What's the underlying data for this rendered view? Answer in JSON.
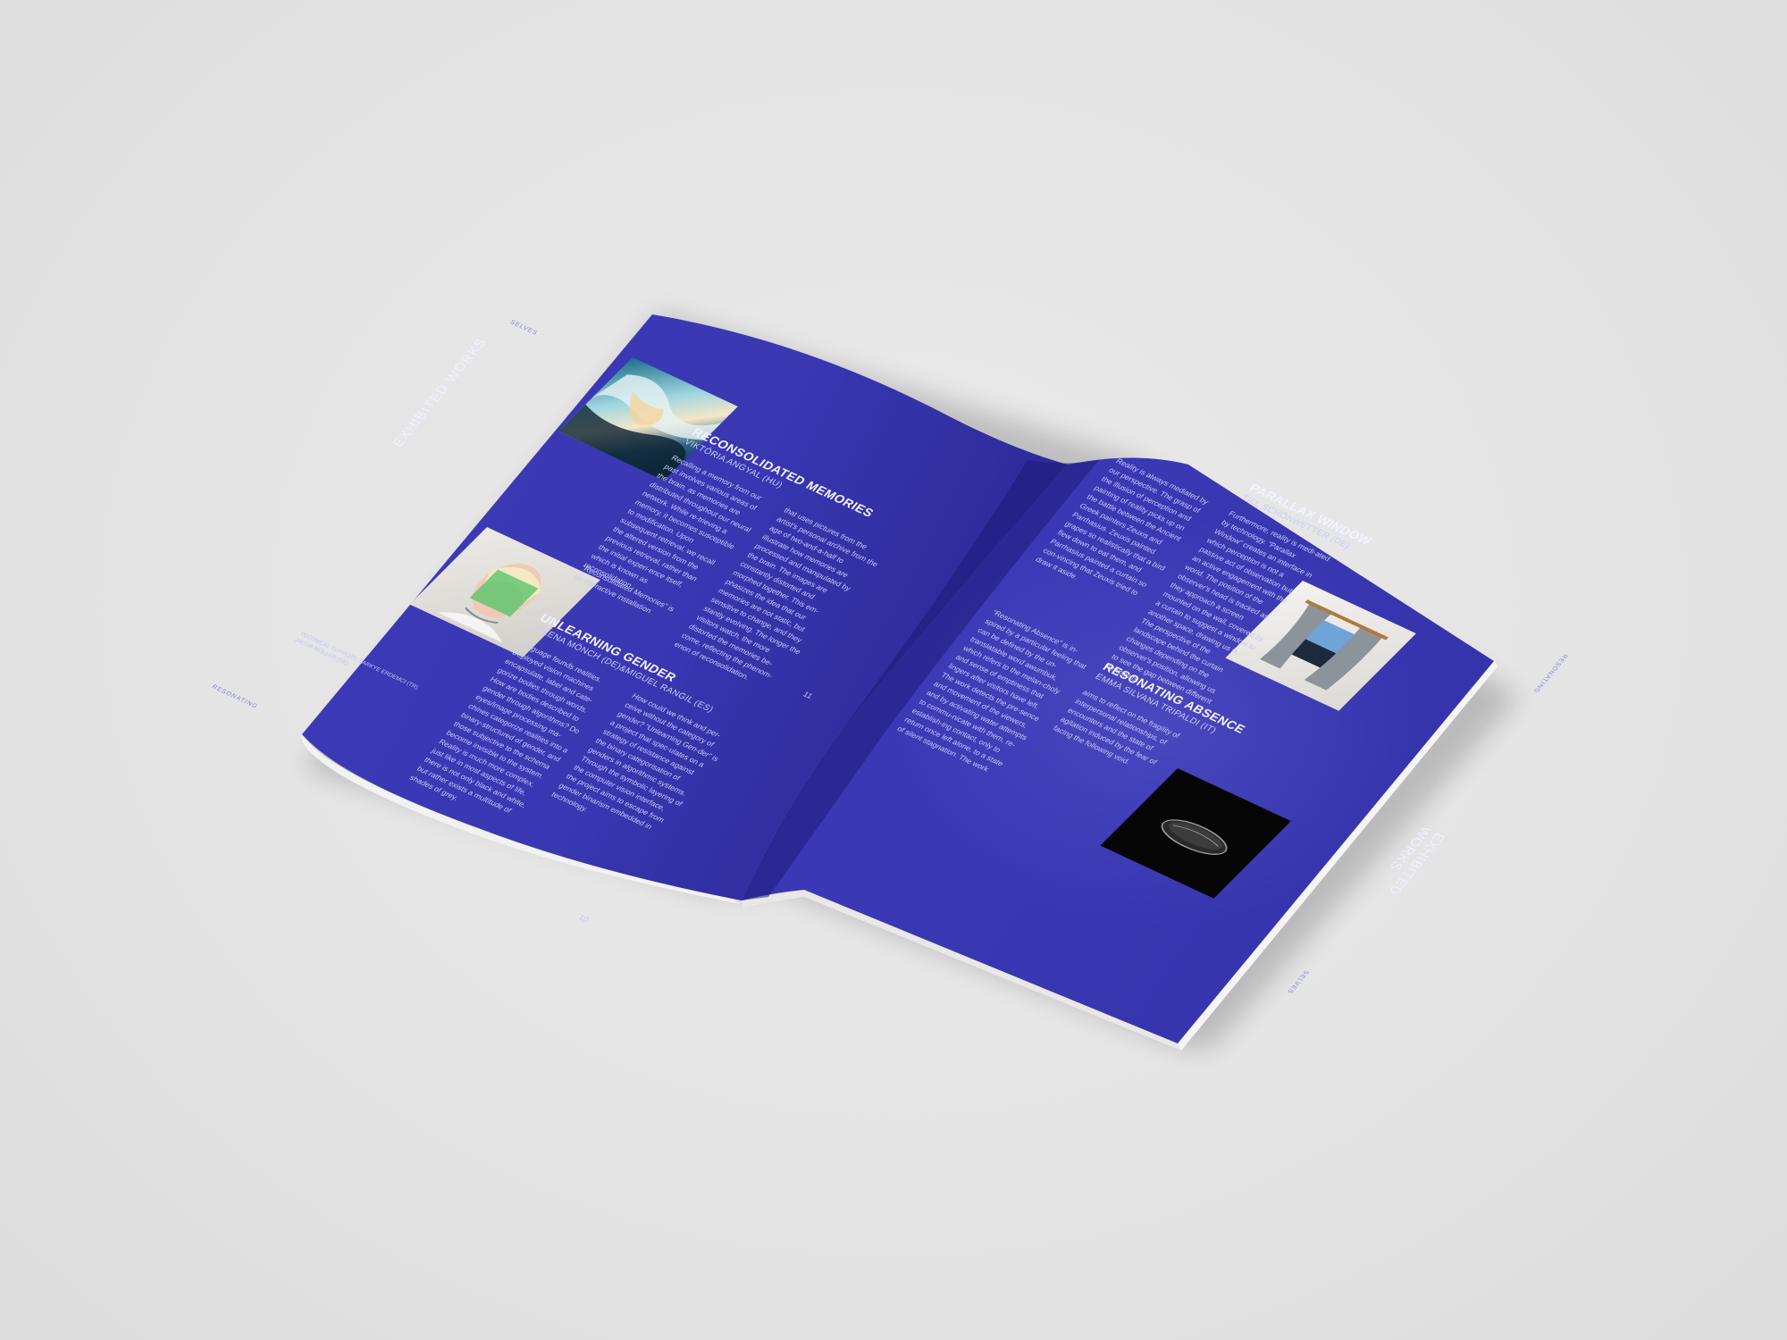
{
  "left_page": {
    "section_label": "EXHIBITED WORKS",
    "running_head_top": "SELVES",
    "running_head_bottom": "RESONATING",
    "page_number": "10",
    "works": [
      {
        "title": "RECONSOLIDATED MEMORIES",
        "artist": "VIKTÓRIA ANGYAL (HU)",
        "col1": "Recalling a memory from our past involves various areas of the brain, as memories are distributed throughout our neural network. While re-trieving a memory, it becomes susceptible to modification. Upon subsequent retrieval, we recall the altered version from the previous retrieval, rather than the initial experi-ence itself, which is known as reconsolidation.",
        "col1b": "“Reconsolidated Memories” is an interactive installation",
        "col2": "that uses pictures from the artist's personal archive from the age of two-and-a-half to illustrate how memories are processed and manipulated by the brain. The images are constantly distorted and morphed together. This em-phasizes the idea that our memories are not static, but sensitive to change, and they stantly evolving. The longer the visitors watch, the more distorted the memories be-come, reflecting the phenom-enon of reconsolidation."
      },
      {
        "title": "UNLEARNING GENDER",
        "artist": "JELENA MÖNCH (DE)&MIGUEL RANGIL (ES)",
        "credit": "TECHNICAL SUPPORT: Sarkye Erdemci (TR), Jacob Möller (DE)",
        "col1": "Language founds realities. Deployed vision machines encapsulate, label and cate-gorize bodies through words. How are bodies described to gender through algorithms? Do eyes/image processing ma-chines categorize realities into a binary-structured of gender, and those subjective to the schema become invisible to the system. Reality is much more complex, just like in most aspects of life, there is not only black and white, but rather exists a multitude of shades of grey.",
        "col2": "How could we think and per-ceive without the category of gender? “Unlearning Gen-der” is a project that spec-ulates on a strategy of resistance against the binary categorisation of genders in algorithmic systems. Through the symbolic layering of the computer vision interface, the project aims to escape from gender binarism embedded in technology."
      }
    ]
  },
  "right_page": {
    "section_label": "EXHIBITED WORKS",
    "running_head_top": "RESONATING",
    "running_head_bottom": "SELVES",
    "page_number": "11",
    "works": [
      {
        "title": "PARALLAX WINDOW",
        "artist": "TILL SCHÖNWETTER (DE)",
        "col1": "Reality is always mediated by our perspective. The grasp of the illusion of perception and painting of reality picks up on the battle between the Ancient Greek painters Zeuxis and Parrhasius. Zeuxis painted grapes so realistically that a bird flew down to eat them, and Parrhasius painted a curtain so con-vincing that Zeuxis tried to draw it aside.",
        "col2": "Furthermore, reality is medi-ated by technology. “Parallax Window” creates an interface in which perception is not a passive act of observation but an active engagement with the world. The position of the observer's head is tracked as they approach a screen mounted on the wall, covered by a curtain to suggest a window to another space, drawing us in. The perspective of the landscape behind the curtain changes depending on the observer's position, allowing us to see the gap between different viewpoints."
      },
      {
        "title": "RESONATING ABSENCE",
        "artist": "EMMA SILVANA TRIPALDI (IT)",
        "col1": "“Resonating Absence” is in-spired by a particular feeling that can be defined by the un-translatable word awumbuk, which refers to the melan-choly and sense of emptiness that lingers after visitors have left. The work detects the pre-sence and movement of the viewers, and by activating water attempts to commu-nicate with them, re-establish-ing contact, only to return once left alone, to a state of silent stagnation. The work",
        "col2": "aims to reflect on the fragility of interpersonal relationships, of encounters and the state of agitation induced by the fear of facing the following void."
      }
    ]
  },
  "colors": {
    "paper": "#3a39b4",
    "paper_dark": "#2a2894",
    "text": "#c6caf3",
    "title": "#f2f3ff",
    "background": "#e6e6e6"
  }
}
